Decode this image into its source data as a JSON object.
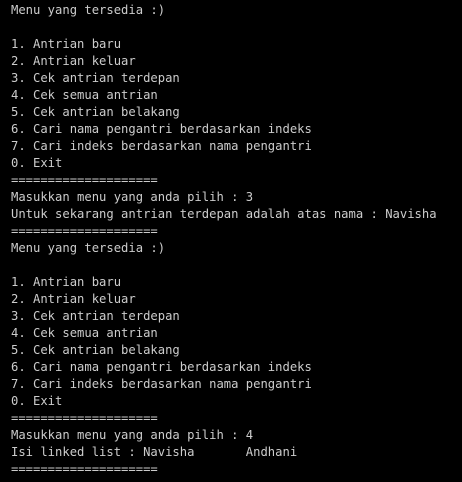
{
  "terminal": {
    "lines": [
      "Menu yang tersedia :)",
      "",
      "1. Antrian baru",
      "2. Antrian keluar",
      "3. Cek antrian terdepan",
      "4. Cek semua antrian",
      "5. Cek antrian belakang",
      "6. Cari nama pengantri berdasarkan indeks",
      "7. Cari indeks berdasarkan nama pengantri",
      "0. Exit",
      "====================",
      "Masukkan menu yang anda pilih : 3",
      "Untuk sekarang antrian terdepan adalah atas nama : Navisha",
      "====================",
      "Menu yang tersedia :)",
      "",
      "1. Antrian baru",
      "2. Antrian keluar",
      "3. Cek antrian terdepan",
      "4. Cek semua antrian",
      "5. Cek antrian belakang",
      "6. Cari nama pengantri berdasarkan indeks",
      "7. Cari indeks berdasarkan nama pengantri",
      "0. Exit",
      "====================",
      "Masukkan menu yang anda pilih : 4",
      "Isi linked list : Navisha       Andhani",
      "===================="
    ]
  },
  "colors": {
    "background": "#000000",
    "text": "#cccccc"
  }
}
